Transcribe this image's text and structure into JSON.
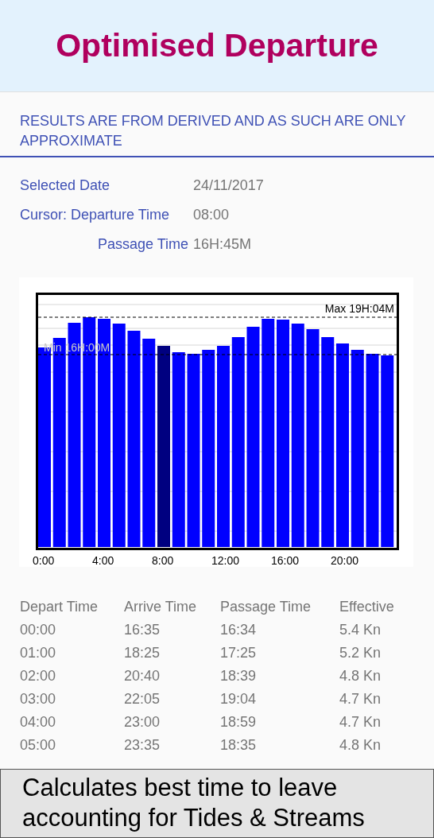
{
  "header": {
    "title": "Optimised Departure"
  },
  "notice": "RESULTS ARE FROM DERIVED AND AS SUCH ARE ONLY APPROXIMATE",
  "details": [
    {
      "label": "Selected Date",
      "value": "24/11/2017"
    },
    {
      "label": "Cursor: Departure Time",
      "value": "08:00"
    },
    {
      "label": "Passage Time",
      "value": "16H:45M"
    }
  ],
  "chart": {
    "max_label": "Max 19H:04M",
    "min_label": "Min 16H:00M",
    "x_labels": [
      "0:00",
      "4:00",
      "8:00",
      "12:00",
      "16:00",
      "20:00"
    ],
    "bars": [
      {
        "selected": false
      },
      {
        "selected": false
      },
      {
        "selected": false
      },
      {
        "selected": false
      },
      {
        "selected": false
      },
      {
        "selected": false
      },
      {
        "selected": false
      },
      {
        "selected": false
      },
      {
        "selected": true
      },
      {
        "selected": false
      },
      {
        "selected": false
      },
      {
        "selected": false
      },
      {
        "selected": false
      },
      {
        "selected": false
      },
      {
        "selected": false
      },
      {
        "selected": false
      },
      {
        "selected": false
      },
      {
        "selected": false
      },
      {
        "selected": false
      },
      {
        "selected": false
      },
      {
        "selected": false
      },
      {
        "selected": false
      },
      {
        "selected": false
      },
      {
        "selected": false
      }
    ]
  },
  "table": {
    "columns": [
      "Depart Time",
      "Arrive Time",
      "Passage Time",
      "Effective"
    ],
    "rows": [
      [
        "00:00",
        "16:35",
        "16:34",
        "5.4 Kn"
      ],
      [
        "01:00",
        "18:25",
        "17:25",
        "5.2 Kn"
      ],
      [
        "02:00",
        "20:40",
        "18:39",
        "4.8 Kn"
      ],
      [
        "03:00",
        "22:05",
        "19:04",
        "4.7 Kn"
      ],
      [
        "04:00",
        "23:00",
        "18:59",
        "4.7 Kn"
      ],
      [
        "05:00",
        "23:35",
        "18:35",
        "4.8 Kn"
      ]
    ]
  },
  "caption": [
    "Calculates best time to leave",
    "accounting for Tides & Streams"
  ]
}
